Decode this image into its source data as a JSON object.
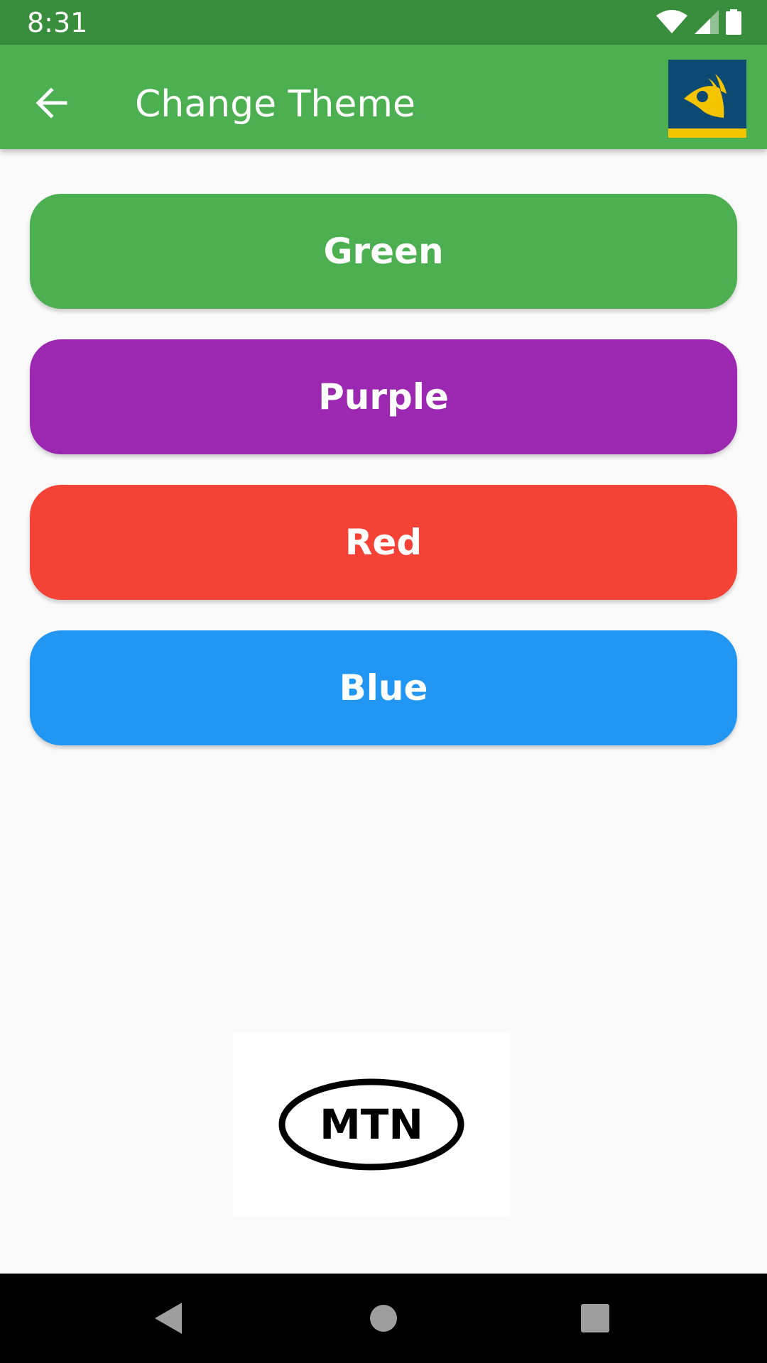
{
  "status_bar": {
    "time": "8:31",
    "icons": [
      "wifi-icon",
      "cellular-signal-icon",
      "battery-icon"
    ]
  },
  "app_bar": {
    "back_icon": "arrow-back-icon",
    "title": "Change Theme",
    "logo_icon": "app-logo-icon"
  },
  "themes": [
    {
      "label": "Green",
      "color": "#4caf50"
    },
    {
      "label": "Purple",
      "color": "#9c27b0"
    },
    {
      "label": "Red",
      "color": "#f44336"
    },
    {
      "label": "Blue",
      "color": "#2196f3"
    }
  ],
  "sponsor": {
    "logo_text": "MTN"
  },
  "nav_bar": {
    "icons": [
      "nav-back-icon",
      "nav-home-icon",
      "nav-recents-icon"
    ]
  },
  "colors": {
    "status_bar": "#388e3c",
    "app_bar": "#4caf50",
    "background": "#fafafa"
  }
}
